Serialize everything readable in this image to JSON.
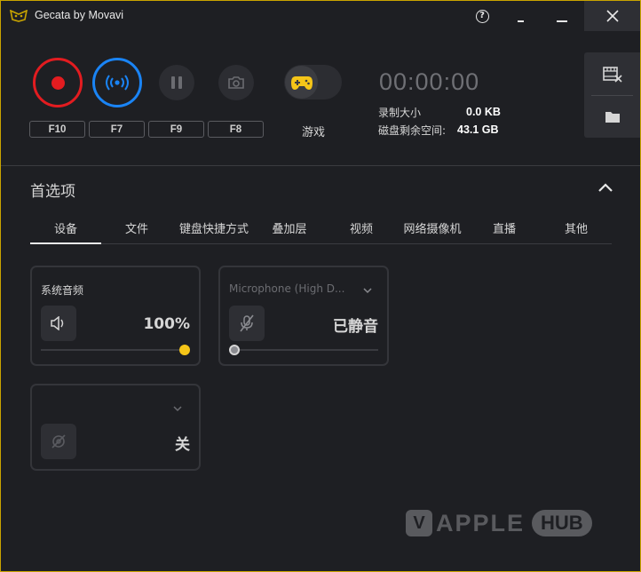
{
  "app": {
    "title": "Gecata by Movavi",
    "accent": "#c9a400"
  },
  "titlebar": {
    "help_label": "?",
    "help_icon": "help-circle-icon",
    "minimize_icons": [
      "minimize-icon",
      "minimize-icon"
    ],
    "close_icon": "close-icon"
  },
  "controls": {
    "record": {
      "hotkey": "F10",
      "color": "#e31c20",
      "icon": "record-icon"
    },
    "stream": {
      "hotkey": "F7",
      "color": "#1a84f5",
      "icon": "broadcast-icon"
    },
    "pause": {
      "hotkey": "F9",
      "icon": "pause-icon"
    },
    "screenshot": {
      "hotkey": "F8",
      "icon": "camera-icon"
    },
    "game_mode": {
      "label": "游戏",
      "icon": "gamepad-icon",
      "icon_color": "#f5c518",
      "enabled": false
    }
  },
  "status": {
    "timer": "00:00:00",
    "rec_size_label": "录制大小",
    "rec_size_value": "0.0 KB",
    "disk_free_label": "磁盘剩余空间:",
    "disk_free_value": "43.1 GB"
  },
  "sidepanel": {
    "icons": [
      "video-edit-icon",
      "folder-icon"
    ]
  },
  "preferences": {
    "title": "首选项",
    "collapse_icon": "chevron-up-icon",
    "tabs": [
      {
        "label": "设备",
        "active": true
      },
      {
        "label": "文件"
      },
      {
        "label": "键盘快捷方式"
      },
      {
        "label": "叠加层"
      },
      {
        "label": "视频"
      },
      {
        "label": "网络摄像机"
      },
      {
        "label": "直播"
      },
      {
        "label": "其他"
      }
    ],
    "devices": {
      "system_audio": {
        "label": "系统音频",
        "value": "100%",
        "level": 1.0,
        "icon": "speaker-icon",
        "knob_color": "#f5c518"
      },
      "microphone": {
        "label": "Microphone (High D...",
        "value": "已静音",
        "level": 0.0,
        "icon": "microphone-muted-icon",
        "knob_color": "#8a8b90"
      },
      "webcam": {
        "label": "",
        "value": "关",
        "icon": "webcam-off-icon"
      }
    }
  },
  "watermark": {
    "brand_mark": "V",
    "brand_text": "APPLE",
    "brand_suffix": "HUB"
  }
}
